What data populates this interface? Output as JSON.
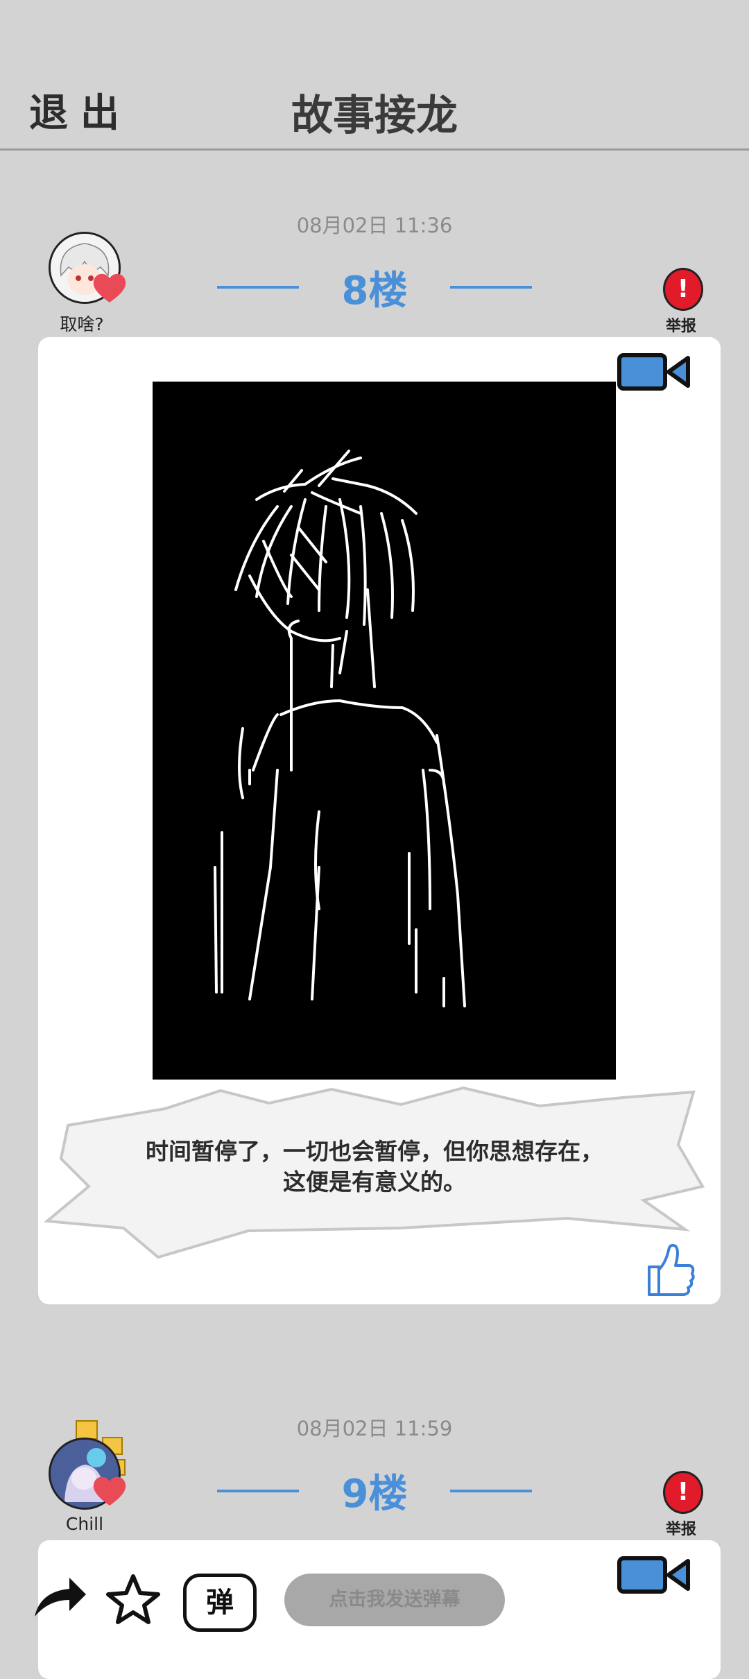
{
  "header": {
    "exit_label": "退出",
    "title": "故事接龙"
  },
  "posts": [
    {
      "time": "08月02日  11:36",
      "floor": "8楼",
      "user": "取啥?",
      "report": "举报",
      "caption_line1": "时间暂停了，一切也会暂停，但你思想存在，",
      "caption_line2": "这便是有意义的。"
    },
    {
      "time": "08月02日  11:59",
      "floor": "9楼",
      "user": "Chill",
      "report": "举报"
    }
  ],
  "toolbar": {
    "danmu_placeholder": "点击我发送弹幕",
    "danmu_icon_text": "弹"
  },
  "colors": {
    "accent": "#4a90d9",
    "report": "#e21b2a",
    "background": "#d3d3d3"
  }
}
